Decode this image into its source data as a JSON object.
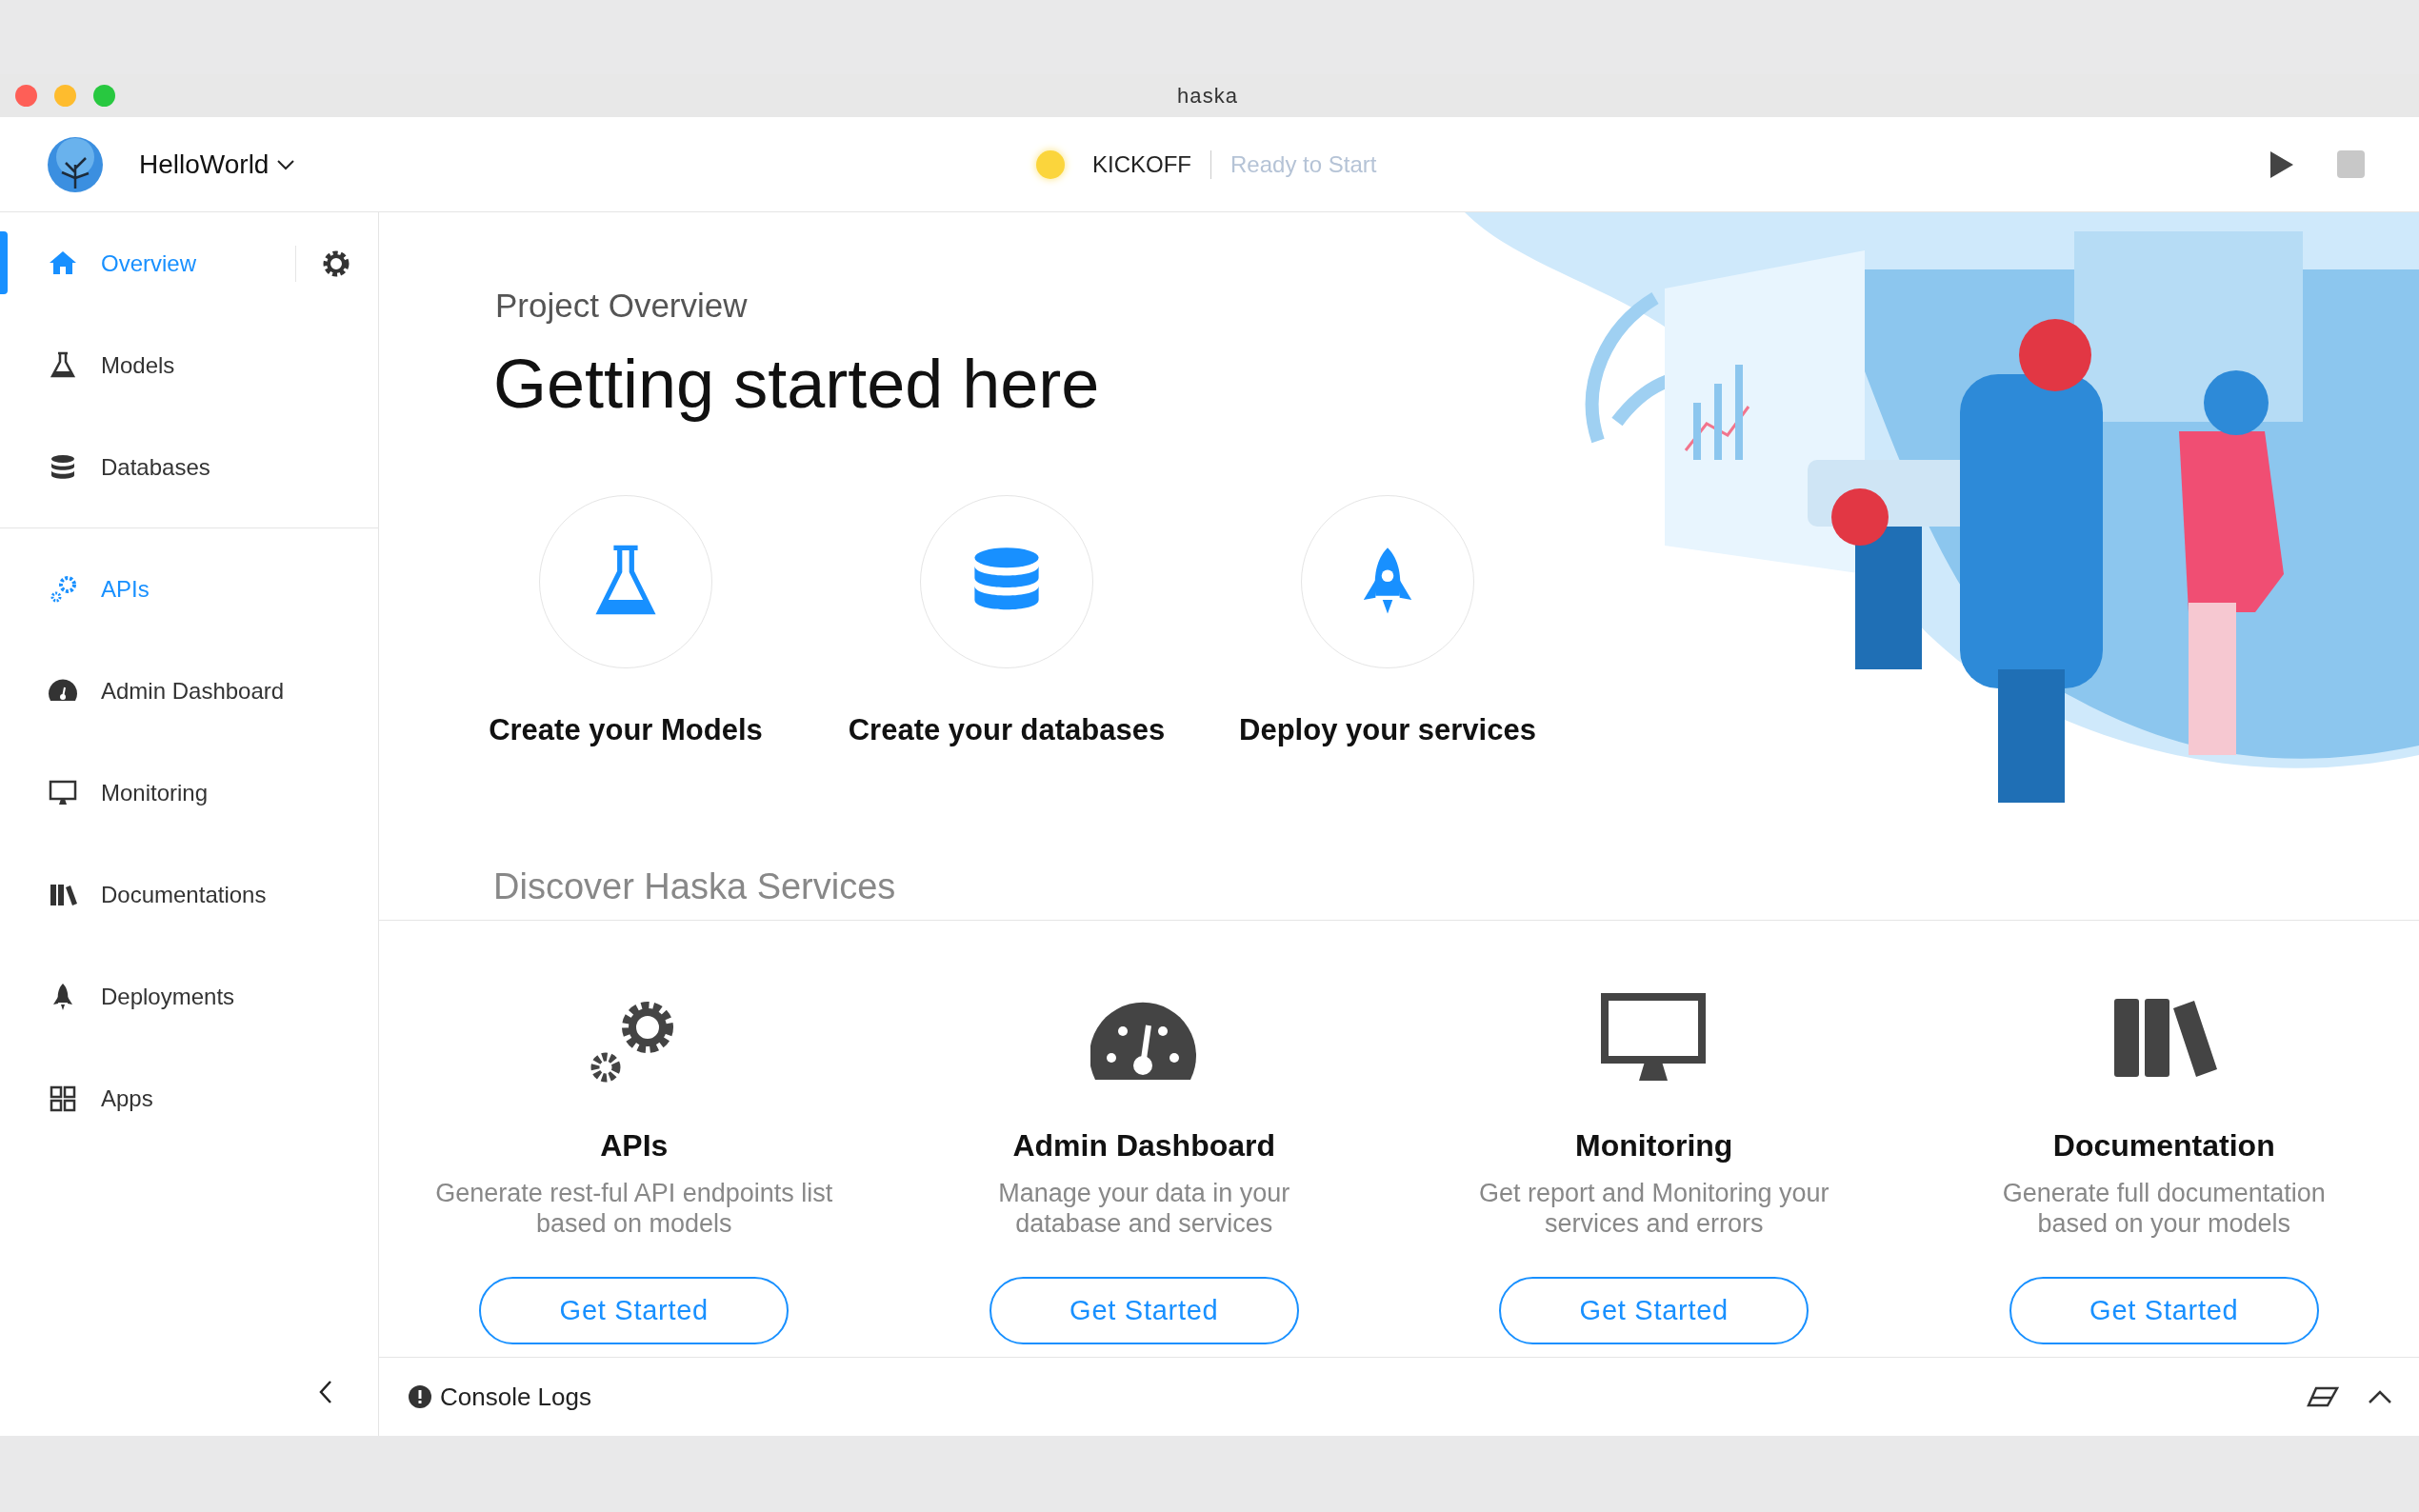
{
  "window": {
    "title": "haska"
  },
  "header": {
    "project": "HelloWorld",
    "status": "KICKOFF",
    "status_detail": "Ready to Start"
  },
  "sidebar": {
    "sections": [
      {
        "items": [
          {
            "label": "Overview",
            "selected": true,
            "highlighted": true
          },
          {
            "label": "Models",
            "selected": false,
            "highlighted": false
          },
          {
            "label": "Databases",
            "selected": false,
            "highlighted": false
          }
        ]
      },
      {
        "items": [
          {
            "label": "APIs",
            "selected": false,
            "highlighted": true
          },
          {
            "label": "Admin Dashboard",
            "selected": false,
            "highlighted": false
          },
          {
            "label": "Monitoring",
            "selected": false,
            "highlighted": false
          },
          {
            "label": "Documentations",
            "selected": false,
            "highlighted": false
          },
          {
            "label": "Deployments",
            "selected": false,
            "highlighted": false
          },
          {
            "label": "Apps",
            "selected": false,
            "highlighted": false
          }
        ]
      }
    ]
  },
  "overview": {
    "subtitle": "Project Overview",
    "heading": "Getting started here",
    "steps": [
      {
        "kind": "flask",
        "label": "Create your Models"
      },
      {
        "kind": "database",
        "label": "Create your databases"
      },
      {
        "kind": "rocket",
        "label": "Deploy your services"
      }
    ]
  },
  "services": {
    "title": "Discover Haska Services",
    "cards": [
      {
        "kind": "gears",
        "title": "APIs",
        "description": "Generate rest-ful API endpoints list based on models",
        "button": "Get Started"
      },
      {
        "kind": "gauge",
        "title": "Admin Dashboard",
        "description": "Manage your data in your database and services",
        "button": "Get Started"
      },
      {
        "kind": "monitor",
        "title": "Monitoring",
        "description": "Get report and Monitoring your services and errors",
        "button": "Get Started"
      },
      {
        "kind": "books",
        "title": "Documentation",
        "description": "Generate full documentation based on your models",
        "button": "Get Started"
      }
    ]
  },
  "console": {
    "label": "Console Logs"
  }
}
